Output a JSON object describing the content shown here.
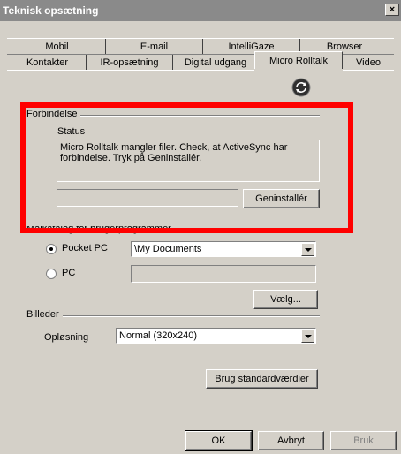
{
  "window": {
    "title": "Teknisk opsætning",
    "close_glyph": "×"
  },
  "tabs_back": [
    "Mobil",
    "E-mail",
    "IntelliGaze",
    "Browser"
  ],
  "tabs_front": [
    "Kontakter",
    "IR-opsætning",
    "Digital udgang",
    "Micro Rolltalk",
    "Video"
  ],
  "active_tab": "Micro Rolltalk",
  "connection": {
    "group_label": "Forbindelse",
    "status_label": "Status",
    "status_text": "Micro Rolltalk mangler filer. Check, at ActiveSync har forbindelse. Tryk på Geninstallér.",
    "progress_value": "",
    "reinstall_button": "Geninstallér"
  },
  "target_folder": {
    "group_label": "Målkatalog for brugerprogrammer",
    "pocket_pc_label": "Pocket PC",
    "pocket_pc_value": "\\My Documents",
    "pc_label": "PC",
    "pc_value": "",
    "choose_button": "Vælg..."
  },
  "images": {
    "group_label": "Billeder",
    "resolution_label": "Opløsning",
    "resolution_value": "Normal (320x240)"
  },
  "defaults_button": "Brug standardværdier",
  "footer": {
    "ok": "OK",
    "cancel": "Avbryt",
    "apply": "Bruk"
  },
  "icons": {
    "sync": "sync-icon"
  },
  "colors": {
    "highlight_box": "#ff0000",
    "dialog_bg": "#d4d0c8",
    "titlebar": "#8a8a8a"
  }
}
